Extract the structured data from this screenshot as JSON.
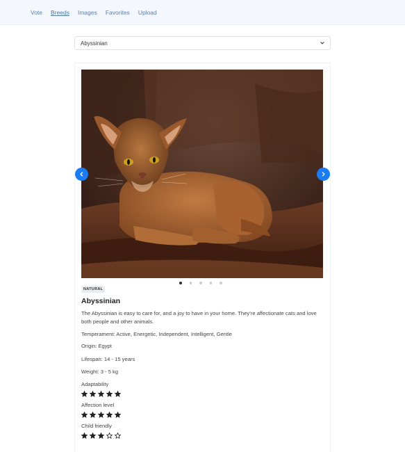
{
  "nav": {
    "links": [
      "Vote",
      "Breeds",
      "Images",
      "Favorites",
      "Upload"
    ],
    "active": "Breeds"
  },
  "breed_select": {
    "selected": "Abyssinian"
  },
  "carousel": {
    "slide_count": 5,
    "active_index": 0
  },
  "breed": {
    "badge": "NATURAL",
    "name": "Abyssinian",
    "description": "The Abyssinian is easy to care for, and a joy to have in your home. They’re affectionate cats and love both people and other animals.",
    "temperament": "Temperament: Active, Energetic, Independent, Intelligent, Gentle",
    "origin": "Origin: Egypt",
    "lifespan": "Lifespan: 14 - 15 years",
    "weight": "Weight: 3 - 5 kg",
    "ratings": [
      {
        "label": "Adaptability",
        "value": 5,
        "max": 5
      },
      {
        "label": "Affection level",
        "value": 5,
        "max": 5
      },
      {
        "label": "Child friendly",
        "value": 3,
        "max": 5
      }
    ]
  },
  "colors": {
    "accent": "#1a7cf0",
    "navbar_bg": "#f4f8fc",
    "nav_link": "#5a7fa8"
  }
}
